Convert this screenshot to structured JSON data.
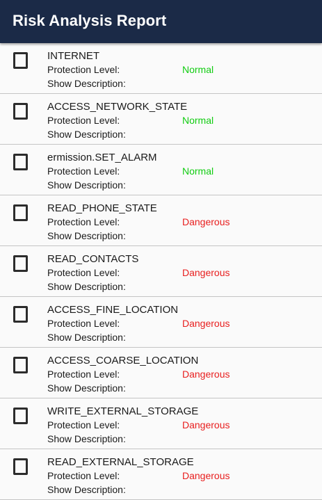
{
  "appbar": {
    "title": "Risk Analysis Report",
    "background": "#1b2a47"
  },
  "colors": {
    "normal": "#11cc11",
    "dangerous": "#e81e1e"
  },
  "permissions": [
    {
      "name": "INTERNET",
      "level_label": "Protection Level:",
      "level": "Normal",
      "level_type": "normal",
      "description_label": "Show Description:",
      "checked": false
    },
    {
      "name": "ACCESS_NETWORK_STATE",
      "level_label": "Protection Level:",
      "level": "Normal",
      "level_type": "normal",
      "description_label": "Show Description:",
      "checked": false
    },
    {
      "name": "ermission.SET_ALARM",
      "level_label": "Protection Level:",
      "level": "Normal",
      "level_type": "normal",
      "description_label": "Show Description:",
      "checked": false
    },
    {
      "name": "READ_PHONE_STATE",
      "level_label": "Protection Level:",
      "level": "Dangerous",
      "level_type": "dangerous",
      "description_label": "Show Description:",
      "checked": false
    },
    {
      "name": "READ_CONTACTS",
      "level_label": "Protection Level:",
      "level": "Dangerous",
      "level_type": "dangerous",
      "description_label": "Show Description:",
      "checked": false
    },
    {
      "name": "ACCESS_FINE_LOCATION",
      "level_label": "Protection Level:",
      "level": "Dangerous",
      "level_type": "dangerous",
      "description_label": "Show Description:",
      "checked": false
    },
    {
      "name": "ACCESS_COARSE_LOCATION",
      "level_label": "Protection Level:",
      "level": "Dangerous",
      "level_type": "dangerous",
      "description_label": "Show Description:",
      "checked": false
    },
    {
      "name": "WRITE_EXTERNAL_STORAGE",
      "level_label": "Protection Level:",
      "level": "Dangerous",
      "level_type": "dangerous",
      "description_label": "Show Description:",
      "checked": false
    },
    {
      "name": "READ_EXTERNAL_STORAGE",
      "level_label": "Protection Level:",
      "level": "Dangerous",
      "level_type": "dangerous",
      "description_label": "Show Description:",
      "checked": false
    }
  ]
}
